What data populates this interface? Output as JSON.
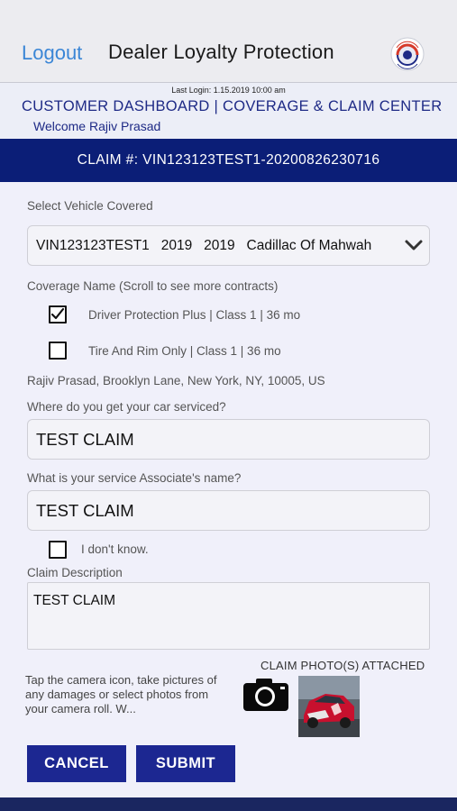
{
  "header": {
    "logout_label": "Logout",
    "title": "Dealer Loyalty Protection"
  },
  "info": {
    "last_login": "Last Login: 1.15.2019 10:00 am",
    "dashboard_title": "CUSTOMER DASHBOARD | COVERAGE & CLAIM CENTER",
    "welcome": "Welcome Rajiv Prasad"
  },
  "claim": {
    "number_label": "CLAIM #: VIN123123TEST1-20200826230716"
  },
  "form": {
    "vehicle_label": "Select Vehicle Covered",
    "vehicle_value": "VIN123123TEST1   2019   2019   Cadillac Of Mahwah",
    "coverage_label": "Coverage Name (Scroll to see more contracts)",
    "coverages": [
      {
        "label": "Driver Protection Plus | Class 1 | 36 mo",
        "checked": true
      },
      {
        "label": "Tire And Rim Only | Class 1 | 36 mo",
        "checked": false
      }
    ],
    "address": "Rajiv Prasad, Brooklyn Lane, New York, NY, 10005, US",
    "service_label": "Where do you get your car serviced?",
    "service_value": "TEST CLAIM",
    "associate_label": "What is your service Associate's name?",
    "associate_value": "TEST CLAIM",
    "dont_know_label": "I don't know.",
    "description_label": "Claim Description",
    "description_value": "TEST CLAIM",
    "photos_label": "CLAIM PHOTO(S) ATTACHED",
    "photo_hint": "Tap the camera icon, take pictures of any damages or select photos from your camera roll. W...",
    "cancel_label": "CANCEL",
    "submit_label": "SUBMIT"
  },
  "icons": {
    "logo": "dealer-logo-icon",
    "dropdown": "chevron-down-icon",
    "camera": "camera-icon",
    "checkbox_checked": "checkmark-icon"
  },
  "colors": {
    "brand_navy": "#0b1e77",
    "button_blue": "#1c2791",
    "link_blue": "#3b86d6",
    "header_text_blue": "#1e2a86"
  }
}
